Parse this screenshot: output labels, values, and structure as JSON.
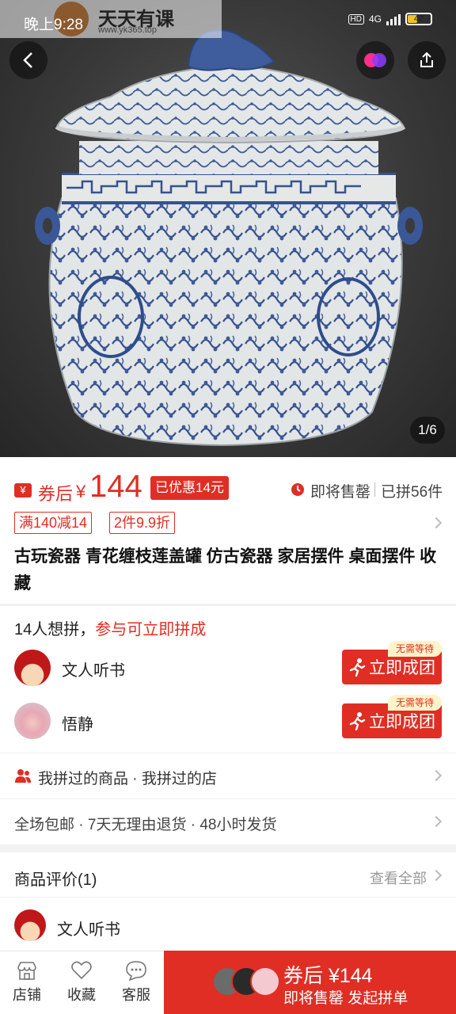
{
  "status_bar": {
    "time": "晚上9:28",
    "watermark_title": "天天有课",
    "watermark_url": "www.yk365.top",
    "hd": "HD",
    "network": "4G",
    "battery": "42"
  },
  "gallery": {
    "counter": "1/6"
  },
  "price": {
    "coupon_label": "券后",
    "currency": "¥",
    "value": "144",
    "discount_badge": "已优惠14元",
    "soon_sold_out": "即将售罄",
    "sold_count": "已拼56件"
  },
  "promotions": [
    "满140减14",
    "2件9.9折"
  ],
  "product_title": "古玩瓷器 青花缠枝莲盖罐 仿古瓷器 家居摆件 桌面摆件 收藏",
  "group_buy": {
    "want_prefix": "14人想拼，",
    "want_cta": "参与可立即拼成",
    "groups": [
      {
        "name": "文人听书",
        "no_wait": "无需等待",
        "button": "立即成团"
      },
      {
        "name": "悟静",
        "no_wait": "无需等待",
        "button": "立即成团"
      }
    ]
  },
  "history": {
    "items": "我拼过的商品 · 我拼过的店"
  },
  "services": {
    "text": "全场包邮 · 7天无理由退货 · 48小时发货"
  },
  "reviews": {
    "title": "商品评价(1)",
    "view_all": "查看全部",
    "first_reviewer": "文人听书"
  },
  "bottom_bar": {
    "tabs": [
      "店铺",
      "收藏",
      "客服"
    ],
    "buy_line1": "券后 ¥144",
    "buy_line2": "即将售罄 发起拼单"
  },
  "colors": {
    "accent": "#e02e24",
    "no_wait_bg": "#fff3c9"
  }
}
